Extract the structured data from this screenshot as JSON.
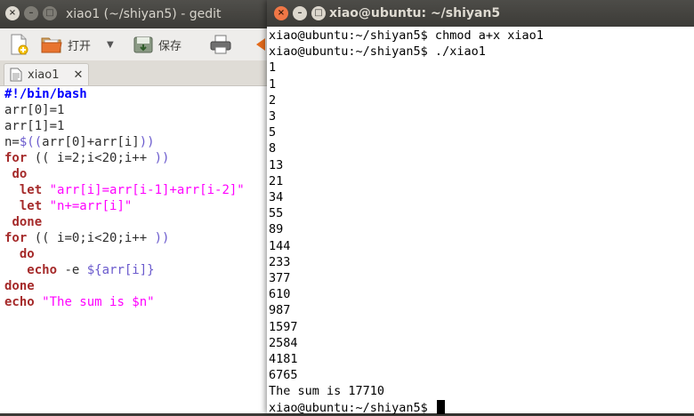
{
  "gedit": {
    "title": "xiao1 (~/shiyan5) - gedit",
    "toolbar": {
      "open_label": "打开",
      "save_label": "保存"
    },
    "tab": {
      "label": "xiao1",
      "close": "✕"
    },
    "code_lines": [
      "#!/bin/bash",
      "arr[0]=1",
      "arr[1]=1",
      "n=$((arr[0]+arr[i]))",
      "for (( i=2;i<20;i++ ))",
      " do",
      "  let \"arr[i]=arr[i-1]+arr[i-2]\"",
      "  let \"n+=arr[i]\"",
      " done",
      "for (( i=0;i<20;i++ ))",
      "  do",
      "   echo -e ${arr[i]}",
      "done",
      "echo \"The sum is $n\""
    ]
  },
  "terminal": {
    "title": "xiao@ubuntu: ~/shiyan5",
    "lines": [
      "xiao@ubuntu:~/shiyan5$ chmod a+x xiao1",
      "xiao@ubuntu:~/shiyan5$ ./xiao1",
      "1",
      "1",
      "2",
      "3",
      "5",
      "8",
      "13",
      "21",
      "34",
      "55",
      "89",
      "144",
      "233",
      "377",
      "610",
      "987",
      "1597",
      "2584",
      "4181",
      "6765",
      "The sum is 17710"
    ],
    "prompt": "xiao@ubuntu:~/shiyan5$ "
  },
  "colors": {
    "keyword": "#a52a2a",
    "string": "#ff00ff",
    "variable": "#6a5acd",
    "shebang": "#0000ff"
  },
  "icons": [
    "close-icon",
    "minimize-icon",
    "maximize-icon",
    "new-document-icon",
    "open-folder-icon",
    "dropdown-arrow-icon",
    "save-icon",
    "print-icon",
    "undo-icon",
    "text-document-icon"
  ]
}
